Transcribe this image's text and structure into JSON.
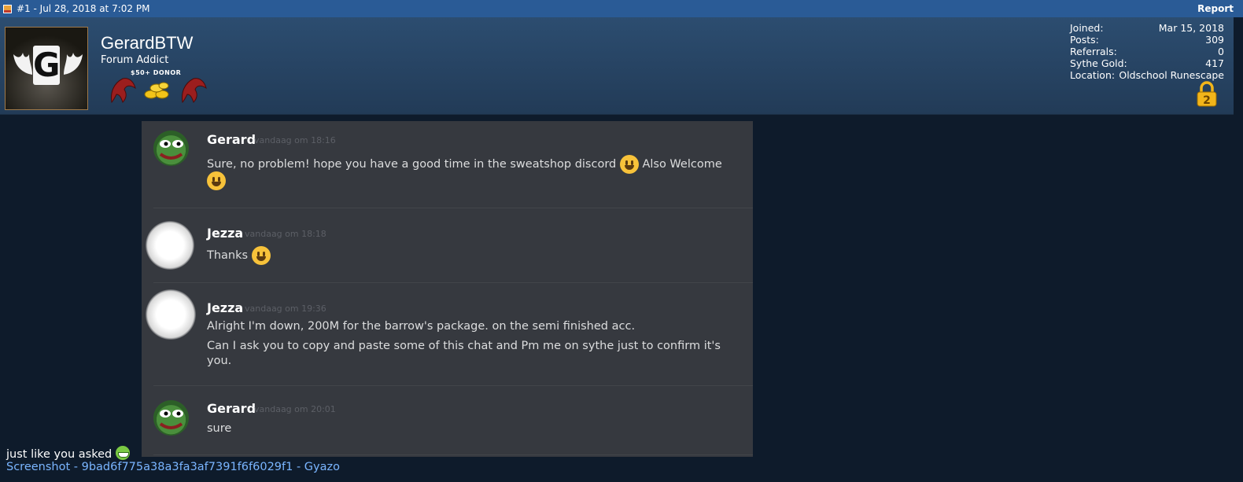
{
  "post": {
    "header": "#1 - Jul 28, 2018 at 7:02 PM",
    "report_label": "Report"
  },
  "user": {
    "name": "GerardBTW",
    "title": "Forum Addict",
    "badge_text": "$50+ DONOR",
    "avatar_letter": "G",
    "stats": [
      {
        "label": "Joined:",
        "value": "Mar 15, 2018"
      },
      {
        "label": "Posts:",
        "value": "309"
      },
      {
        "label": "Referrals:",
        "value": "0"
      },
      {
        "label": "Sythe Gold:",
        "value": "417"
      },
      {
        "label": "Location:",
        "value": "Oldschool Runescape"
      }
    ]
  },
  "chat": {
    "messages": [
      {
        "author": "Gerard",
        "time": "vandaag om 18:16",
        "lines": [
          "Sure, no problem! hope you have a good time in the sweatshop discord",
          "Also Welcome"
        ]
      },
      {
        "author": "Jezza",
        "time": "vandaag om 18:18",
        "lines": [
          "Thanks"
        ]
      },
      {
        "author": "Jezza",
        "time": "vandaag om 19:36",
        "lines": [
          "Alright I'm down, 200M for the barrow's package. on the semi finished acc.",
          "Can I ask you to copy and paste some of this chat and Pm me on sythe just to confirm it's",
          "you."
        ]
      },
      {
        "author": "Gerard",
        "time": "vandaag om 20:01",
        "lines": [
          "sure"
        ]
      }
    ]
  },
  "footer": {
    "caption": "just like you asked",
    "link_text": "Screenshot - 9bad6f775a38a3fa3af7391f6f6029f1 - Gyazo"
  },
  "icons": {
    "status": "post-status-icon",
    "lock": "lock-icon",
    "emoji_smile": "smile-emoji-icon",
    "emoji_grin": "grin-emoji-icon"
  },
  "colors": {
    "post_bar": "#2a5b96",
    "page_bg": "#0e1b2b",
    "discord_bg": "#36393f",
    "link": "#7ab5ff"
  }
}
